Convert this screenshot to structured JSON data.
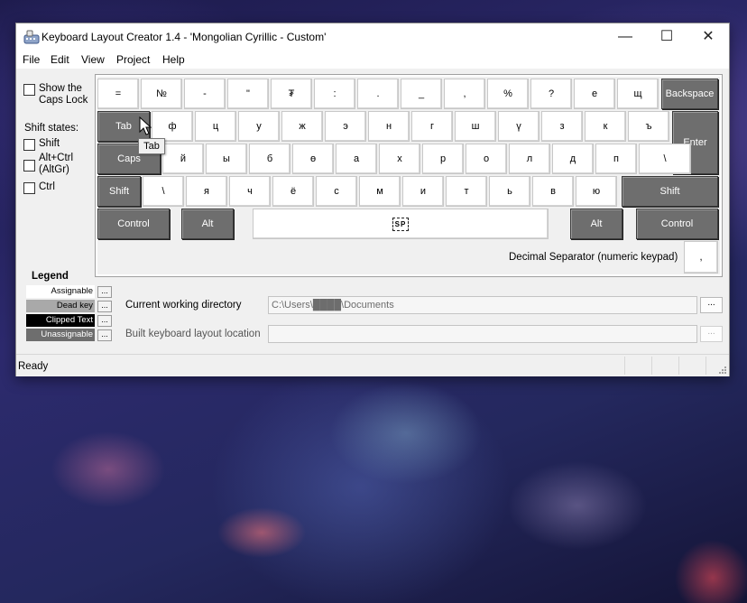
{
  "window": {
    "title": "Keyboard Layout Creator 1.4 - 'Mongolian Cyrillic - Custom'",
    "controls": {
      "minimize": "—",
      "maximize": "☐",
      "close": "✕"
    }
  },
  "menu": [
    "File",
    "Edit",
    "View",
    "Project",
    "Help"
  ],
  "options": {
    "show_caps_lock": "Show the Caps Lock",
    "shift_states_label": "Shift states:",
    "shift": "Shift",
    "altgr": "Alt+Ctrl (AltGr)",
    "ctrl": "Ctrl"
  },
  "keyboard": {
    "row1": [
      "=",
      "№",
      "-",
      "\"",
      "₮",
      ":",
      ".",
      "_",
      ",",
      "%",
      "?",
      "е",
      "щ"
    ],
    "row2": [
      "ф",
      "ц",
      "у",
      "ж",
      "э",
      "н",
      "г",
      "ш",
      "ү",
      "з",
      "к",
      "ъ"
    ],
    "row3": [
      "й",
      "ы",
      "б",
      "ө",
      "а",
      "х",
      "р",
      "о",
      "л",
      "д",
      "п",
      "\\"
    ],
    "row4": [
      "\\",
      "я",
      "ч",
      "ё",
      "с",
      "м",
      "и",
      "т",
      "ь",
      "в",
      "ю"
    ],
    "backspace": "Backspace",
    "tab": "Tab",
    "enter": "Enter",
    "caps": "Caps",
    "shift_left": "Shift",
    "shift_right": "Shift",
    "control_left": "Control",
    "alt_left": "Alt",
    "space": "SP",
    "alt_right": "Alt",
    "control_right": "Control",
    "decimal_label": "Decimal Separator (numeric keypad)",
    "decimal_value": ","
  },
  "tooltip": "Tab",
  "legend": {
    "title": "Legend",
    "items": [
      {
        "label": "Assignable",
        "bg": "#ffffff",
        "fg": "#000000"
      },
      {
        "label": "Dead key",
        "bg": "#a9a9a9",
        "fg": "#000000"
      },
      {
        "label": "Clipped Text",
        "bg": "#000000",
        "fg": "#ffffff"
      },
      {
        "label": "Unassignable",
        "bg": "#6e6e6e",
        "fg": "#ffffff"
      }
    ],
    "button": "..."
  },
  "paths": {
    "cwd_label": "Current working directory",
    "cwd_value": "C:\\Users\\████\\Documents",
    "build_label": "Built keyboard layout location",
    "build_value": "",
    "browse": "..."
  },
  "status": {
    "text": "Ready"
  }
}
